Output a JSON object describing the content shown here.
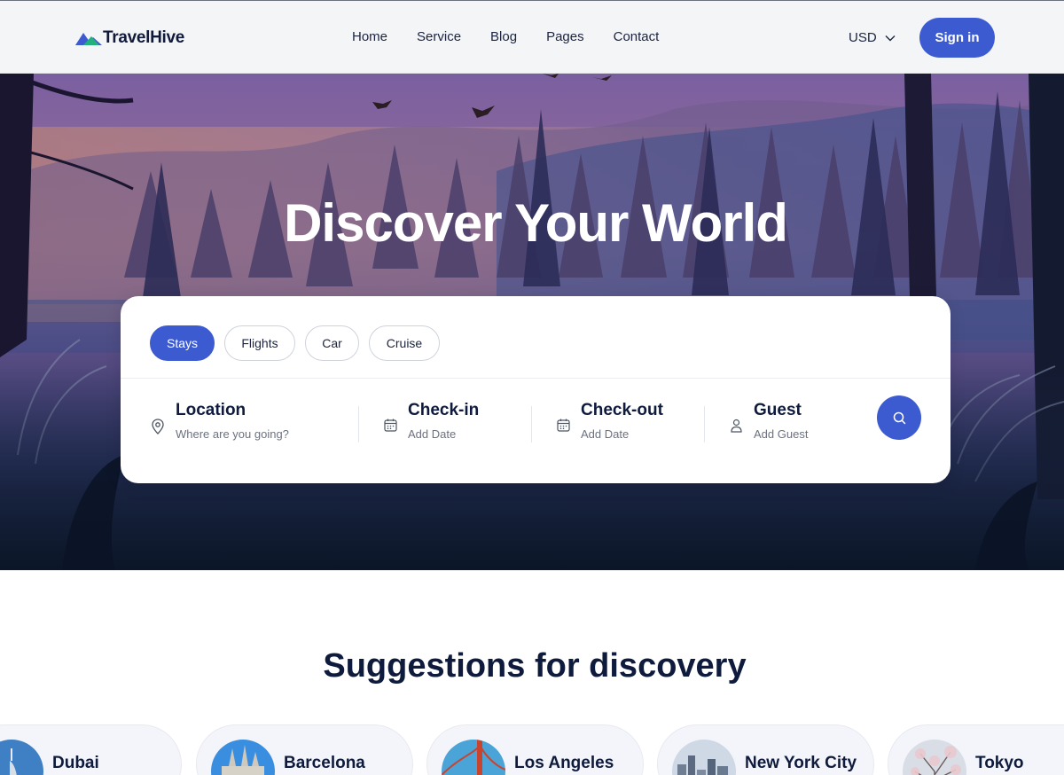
{
  "brand": {
    "name": "TravelHive"
  },
  "nav": {
    "items": [
      "Home",
      "Service",
      "Blog",
      "Pages",
      "Contact"
    ]
  },
  "currency": {
    "selected": "USD"
  },
  "header": {
    "signin_label": "Sign in"
  },
  "hero": {
    "title": "Discover Your World"
  },
  "search": {
    "tabs": [
      {
        "label": "Stays",
        "active": true
      },
      {
        "label": "Flights",
        "active": false
      },
      {
        "label": "Car",
        "active": false
      },
      {
        "label": "Cruise",
        "active": false
      }
    ],
    "fields": [
      {
        "label": "Location",
        "placeholder": "Where are you going?",
        "icon": "map-pin-icon"
      },
      {
        "label": "Check-in",
        "placeholder": "Add Date",
        "icon": "calendar-icon"
      },
      {
        "label": "Check-out",
        "placeholder": "Add Date",
        "icon": "calendar-icon"
      },
      {
        "label": "Guest",
        "placeholder": "Add Guest",
        "icon": "user-icon"
      }
    ],
    "button_icon": "search-icon"
  },
  "suggestions": {
    "title": "Suggestions for discovery",
    "items": [
      {
        "name": "Dubai"
      },
      {
        "name": "Barcelona"
      },
      {
        "name": "Los Angeles"
      },
      {
        "name": "New York City"
      },
      {
        "name": "Tokyo"
      }
    ]
  },
  "colors": {
    "accent": "#3d5bd1",
    "text_dark": "#0f1b3d",
    "header_bg": "#f3f5f7"
  }
}
